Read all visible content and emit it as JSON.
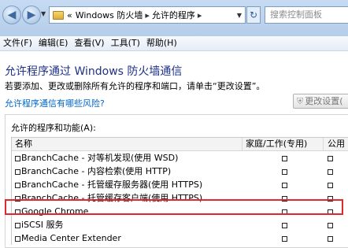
{
  "address": {
    "crumbs": [
      "Windows 防火墙",
      "允许的程序"
    ],
    "prefix": "«"
  },
  "search": {
    "placeholder": "搜索控制面板"
  },
  "menu": [
    "文件(F)",
    "编辑(E)",
    "查看(V)",
    "工具(T)",
    "帮助(H)"
  ],
  "heading": "允许程序通过 Windows 防火墙通信",
  "description": "若要添加、更改或删除所有允许的程序和端口，请单击“更改设置”。",
  "risk_link": "允许程序通信有哪些风险?",
  "change_settings": "更改设置(",
  "list_label": "允许的程序和功能(A):",
  "table": {
    "headers": {
      "name": "名称",
      "home": "家庭/工作(专用)",
      "public": "公用"
    },
    "rows": [
      {
        "name": "BranchCache - 对等机发现(使用 WSD)",
        "home": false,
        "public": false
      },
      {
        "name": "BranchCache - 内容检索(使用 HTTP)",
        "home": false,
        "public": false
      },
      {
        "name": "BranchCache - 托管缓存服务器(使用 HTTPS)",
        "home": false,
        "public": false
      },
      {
        "name": "BranchCache - 托管缓存客户端(使用 HTTPS)",
        "home": false,
        "public": false
      },
      {
        "name": "Google Chrome",
        "home": false,
        "public": false
      },
      {
        "name": "iSCSI 服务",
        "home": false,
        "public": false
      },
      {
        "name": "Media Center Extender",
        "home": false,
        "public": false
      }
    ]
  },
  "colors": {
    "heading": "#1e3287",
    "link": "#0066cc",
    "highlight": "#e0292d"
  }
}
